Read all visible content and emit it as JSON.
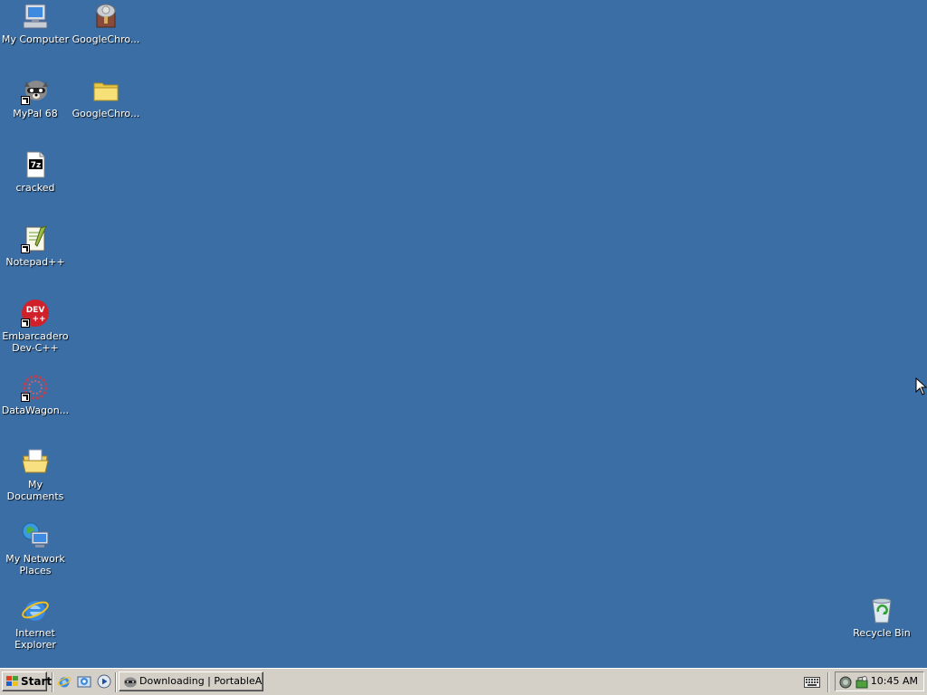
{
  "desktop": {
    "background_color": "#3a6ea5",
    "icons": [
      {
        "label": "My Computer",
        "icon": "my-computer-icon"
      },
      {
        "label": "GoogleChro...",
        "icon": "installer-package-icon"
      },
      {
        "label": "MyPal 68",
        "icon": "mypal-raccoon-icon",
        "shortcut": true
      },
      {
        "label": "GoogleChro...",
        "icon": "folder-icon"
      },
      {
        "label": "cracked",
        "icon": "7z-archive-icon"
      },
      {
        "label": "Notepad++",
        "icon": "notepad-plus-plus-icon",
        "shortcut": true
      },
      {
        "label": "Embarcadero\nDev-C++",
        "icon": "devcpp-icon",
        "shortcut": true
      },
      {
        "label": "DataWagon...",
        "icon": "datawagon-icon",
        "shortcut": true
      },
      {
        "label": "My Documents",
        "icon": "my-documents-icon"
      },
      {
        "label": "My Network\nPlaces",
        "icon": "network-places-icon"
      },
      {
        "label": "Internet\nExplorer",
        "icon": "internet-explorer-icon"
      },
      {
        "label": "Recycle Bin",
        "icon": "recycle-bin-icon"
      }
    ],
    "devcpp_icon_text": [
      "DEV",
      "++"
    ],
    "archive_icon_text": "7z"
  },
  "taskbar": {
    "start_label": "Start",
    "quick_launch": [
      "internet-explorer-icon",
      "outlook-express-icon",
      "media-player-icon"
    ],
    "tasks": [
      {
        "label": "Downloading | PortableA...",
        "icon": "mypal-raccoon-icon"
      }
    ],
    "tray": {
      "icons": [
        "keyboard-icon",
        "network-icon",
        "security-icon"
      ],
      "clock": "10:45 AM"
    }
  }
}
